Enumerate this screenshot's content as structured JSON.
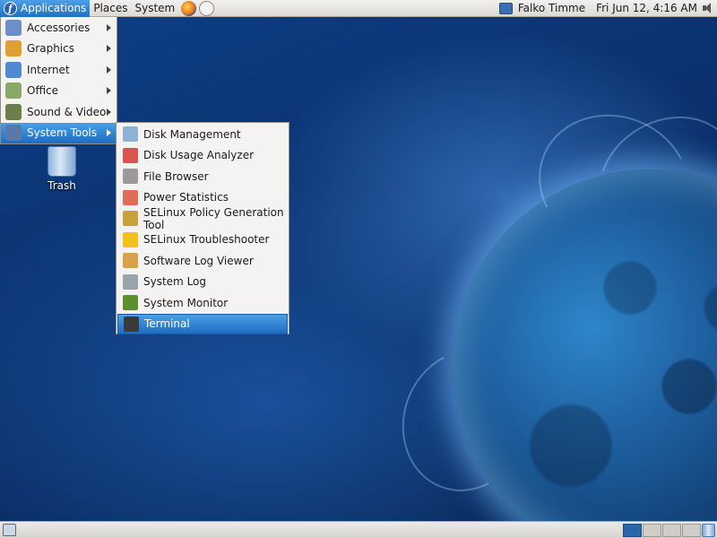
{
  "top_panel": {
    "menus": [
      "Applications",
      "Places",
      "System"
    ],
    "launchers": [
      "firefox-icon",
      "notification-icon"
    ],
    "user_name": "Falko Timme",
    "clock": "Fri Jun 12,  4:16 AM"
  },
  "applications_menu": {
    "items": [
      {
        "label": "Accessories",
        "icon": "accessories-icon",
        "color": "#6d8fc7"
      },
      {
        "label": "Graphics",
        "icon": "graphics-icon",
        "color": "#e0a030"
      },
      {
        "label": "Internet",
        "icon": "internet-icon",
        "color": "#4f8ad1"
      },
      {
        "label": "Office",
        "icon": "office-icon",
        "color": "#8aa866"
      },
      {
        "label": "Sound & Video",
        "icon": "sound-video-icon",
        "color": "#6b7f4a"
      },
      {
        "label": "System Tools",
        "icon": "system-tools-icon",
        "color": "#5a79a8"
      }
    ],
    "selected_index": 5
  },
  "system_tools_menu": {
    "items": [
      {
        "label": "Disk Management",
        "icon": "disk-management-icon",
        "color": "#8eb1d6"
      },
      {
        "label": "Disk Usage Analyzer",
        "icon": "disk-usage-analyzer-icon",
        "color": "#d9534f"
      },
      {
        "label": "File Browser",
        "icon": "file-browser-icon",
        "color": "#9a9a9a"
      },
      {
        "label": "Power Statistics",
        "icon": "power-statistics-icon",
        "color": "#e06c5a"
      },
      {
        "label": "SELinux Policy Generation Tool",
        "icon": "selinux-policy-icon",
        "color": "#c9a13a"
      },
      {
        "label": "SELinux Troubleshooter",
        "icon": "selinux-troubleshooter-icon",
        "color": "#f2c21b"
      },
      {
        "label": "Software Log Viewer",
        "icon": "software-log-viewer-icon",
        "color": "#d8a248"
      },
      {
        "label": "System Log",
        "icon": "system-log-icon",
        "color": "#9aa4ad"
      },
      {
        "label": "System Monitor",
        "icon": "system-monitor-icon",
        "color": "#5c8f2f"
      },
      {
        "label": "Terminal",
        "icon": "terminal-icon",
        "color": "#3a3a3a"
      }
    ],
    "selected_index": 9
  },
  "desktop": {
    "trash_label": "Trash"
  },
  "colors": {
    "selection": "#1c6cc2",
    "panel": "#dcdad5"
  }
}
